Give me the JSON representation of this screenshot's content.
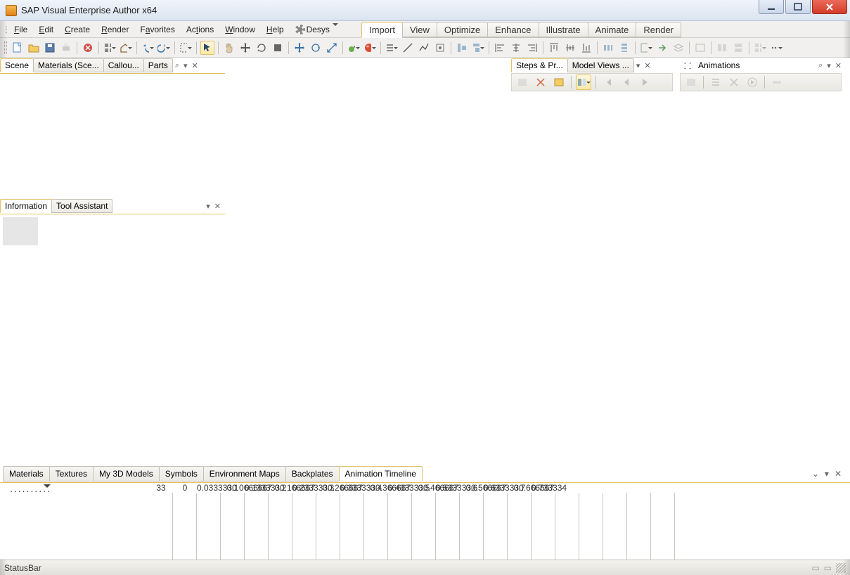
{
  "title": "SAP Visual Enterprise Author x64",
  "menu": [
    "File",
    "Edit",
    "Create",
    "Render",
    "Favorites",
    "Actions",
    "Window",
    "Help",
    "Desys"
  ],
  "workflow_tabs": [
    "Import",
    "View",
    "Optimize",
    "Enhance",
    "Illustrate",
    "Animate",
    "Render"
  ],
  "workflow_active": 0,
  "left_tabs": [
    "Scene",
    "Materials (Sce...",
    "Callou...",
    "Parts"
  ],
  "mid_tabs": [
    "Information",
    "Tool Assistant"
  ],
  "right_panel_a": {
    "tabs": [
      "Steps & Pr...",
      "Model Views ..."
    ]
  },
  "right_panel_b": {
    "title": "Animations"
  },
  "bottom_tabs": [
    "Materials",
    "Textures",
    "My 3D Models",
    "Symbols",
    "Environment Maps",
    "Backplates",
    "Animation Timeline"
  ],
  "bottom_active": 6,
  "timeline_ticks": [
    "33",
    "0",
    "0.0333330.0666667",
    "0.1",
    "0.1333330.166667",
    "0.2",
    "0.2333330.266667",
    "0.3",
    "0.3333330.366667",
    "0.4",
    "0.4333330.466667",
    "0.5",
    "0.5333330.566667",
    "0.6",
    "0.6333330.666667",
    "0.7",
    "0.733334"
  ],
  "timeline_label": "..........",
  "status": "StatusBar"
}
